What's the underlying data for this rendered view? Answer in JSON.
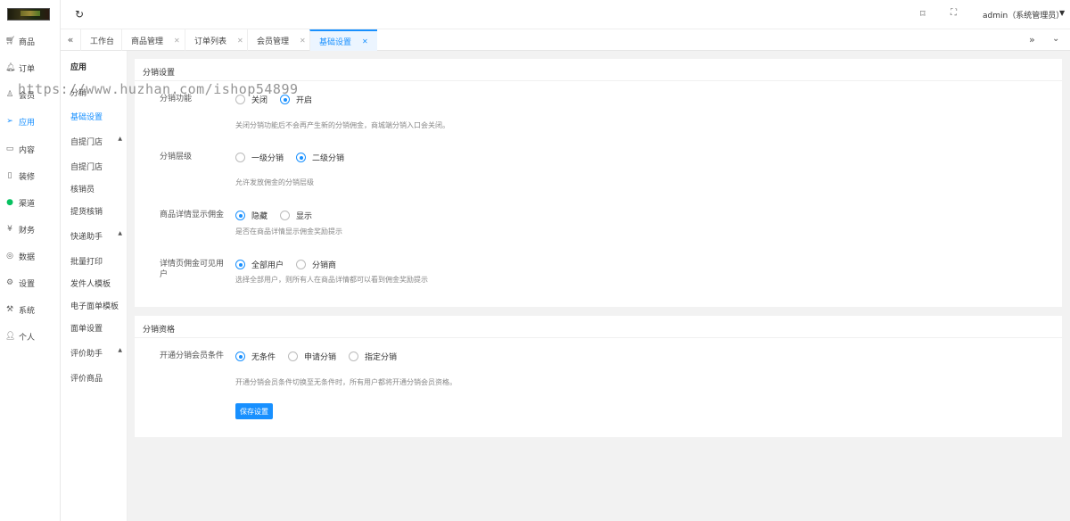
{
  "sidebar": {
    "items": [
      {
        "label": "商品",
        "icon": "cart-icon",
        "active": false
      },
      {
        "label": "订单",
        "icon": "bell-icon",
        "active": false
      },
      {
        "label": "会员",
        "icon": "user-icon",
        "active": false
      },
      {
        "label": "应用",
        "icon": "paper-plane-icon",
        "active": true
      },
      {
        "label": "内容",
        "icon": "book-icon",
        "active": false
      },
      {
        "label": "装修",
        "icon": "phone-icon",
        "active": false
      },
      {
        "label": "渠道",
        "icon": "wechat-icon",
        "active": false
      },
      {
        "label": "财务",
        "icon": "yen-icon",
        "active": false
      },
      {
        "label": "数据",
        "icon": "target-icon",
        "active": false
      },
      {
        "label": "设置",
        "icon": "gear-icon",
        "active": false
      },
      {
        "label": "系统",
        "icon": "system-icon",
        "active": false
      },
      {
        "label": "个人",
        "icon": "person-icon",
        "active": false
      }
    ]
  },
  "header": {
    "user": "admin（系统管理员）"
  },
  "tabs": [
    {
      "label": "工作台",
      "closable": false,
      "active": false
    },
    {
      "label": "商品管理",
      "closable": true,
      "active": false
    },
    {
      "label": "订单列表",
      "closable": true,
      "active": false
    },
    {
      "label": "会员管理",
      "closable": true,
      "active": false
    },
    {
      "label": "基础设置",
      "closable": true,
      "active": true
    }
  ],
  "subnav": {
    "title": "应用",
    "items": [
      "分销",
      "基础设置"
    ],
    "groups": [
      {
        "label": "自提门店",
        "children": [
          "自提门店",
          "核销员",
          "提货核销"
        ]
      },
      {
        "label": "快递助手",
        "children": [
          "批量打印",
          "发件人模板",
          "电子面单模板",
          "面单设置"
        ]
      },
      {
        "label": "评价助手",
        "children": [
          "评价商品"
        ]
      }
    ]
  },
  "section1": {
    "title": "分销设置",
    "fields": [
      {
        "label": "分销功能",
        "options": [
          "关闭",
          "开启"
        ],
        "selected": 1,
        "hint": "关闭分销功能后不会再产生新的分销佣金，商城端分销入口会关闭。"
      },
      {
        "label": "分销层级",
        "options": [
          "一级分销",
          "二级分销"
        ],
        "selected": 1,
        "hint": "允许发放佣金的分销层级"
      },
      {
        "label": "商品详情显示佣金",
        "options": [
          "隐藏",
          "显示"
        ],
        "selected": 0,
        "hint": "是否在商品详情显示佣金奖励提示"
      },
      {
        "label": "详情页佣金可见用户",
        "options": [
          "全部用户",
          "分销商"
        ],
        "selected": 0,
        "hint": "选择全部用户，则所有人在商品详情都可以看到佣金奖励提示"
      }
    ]
  },
  "section2": {
    "title": "分销资格",
    "field": {
      "label": "开通分销会员条件",
      "options": [
        "无条件",
        "申请分销",
        "指定分销"
      ],
      "selected": 0,
      "hint": "开通分销会员条件切换至无条件时，所有用户都将开通分销会员资格。"
    },
    "save_label": "保存设置"
  },
  "watermark": "https://www.huzhan.com/ishop54899"
}
